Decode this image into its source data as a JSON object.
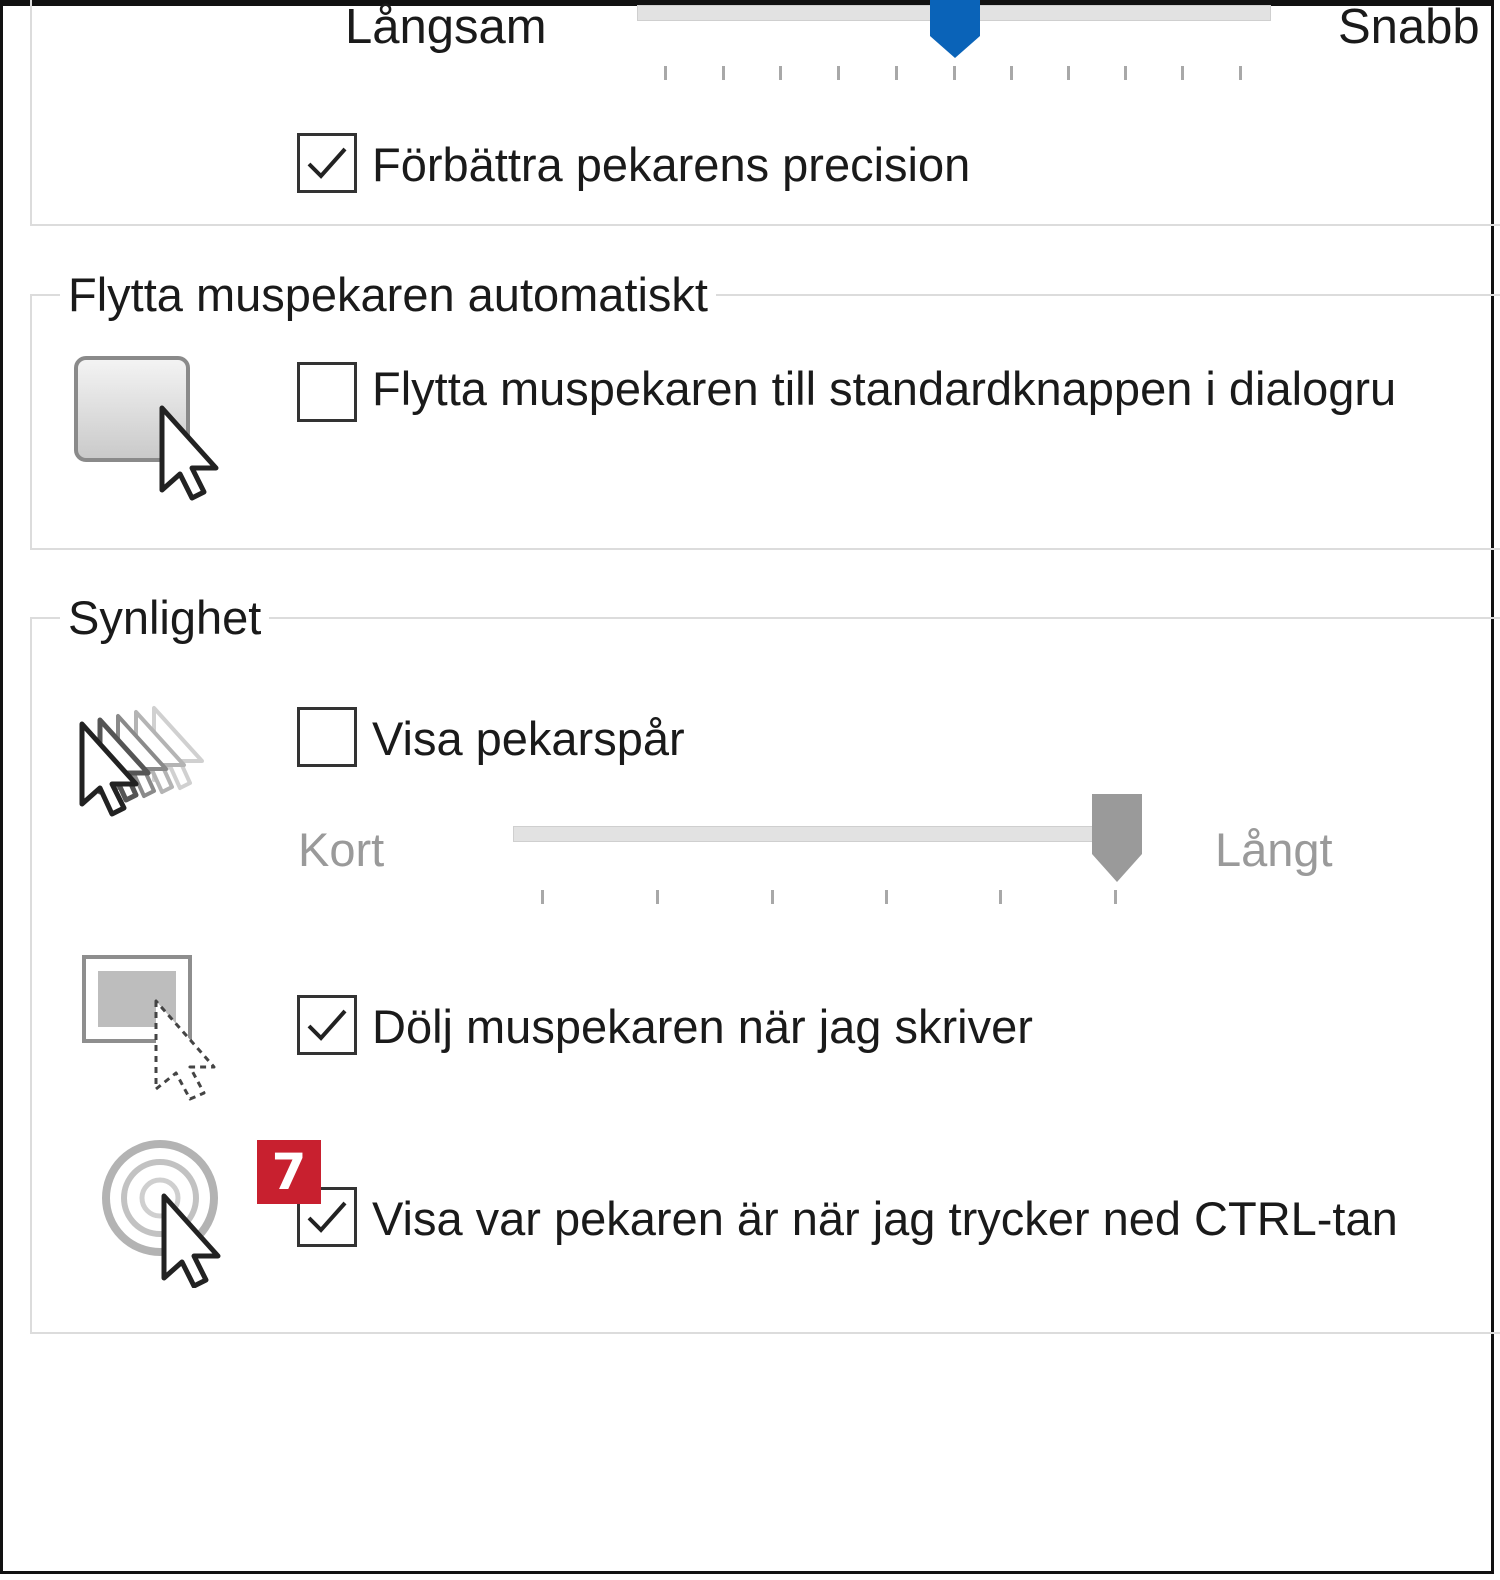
{
  "speed": {
    "slow_label": "Långsam",
    "fast_label": "Snabb",
    "slider_value": 0.5,
    "precision_checkbox": {
      "label": "Förbättra pekarens precision",
      "checked": true
    }
  },
  "snap_to": {
    "legend": "Flytta muspekaren automatiskt",
    "checkbox": {
      "label": "Flytta muspekaren till standardknappen i dialogru",
      "checked": false
    }
  },
  "visibility": {
    "legend": "Synlighet",
    "trails_checkbox": {
      "label": "Visa pekarspår",
      "checked": false
    },
    "trails_short_label": "Kort",
    "trails_long_label": "Långt",
    "trails_slider_value": 1.0,
    "hide_checkbox": {
      "label": "Dölj muspekaren när jag skriver",
      "checked": true
    },
    "ctrl_checkbox": {
      "label": "Visa var pekaren är när jag trycker ned CTRL-tan",
      "checked": true
    }
  },
  "annotation": {
    "step_number": "7",
    "color": "#c8202f"
  },
  "colors": {
    "accent": "#0a63b8",
    "disabled_thumb": "#9a9a9a"
  }
}
